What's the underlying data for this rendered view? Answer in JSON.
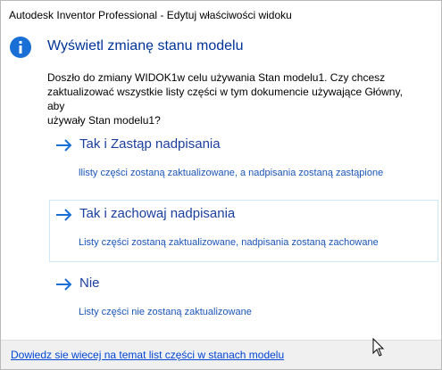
{
  "window": {
    "title": "Autodesk Inventor Professional - Edytuj właściwości widoku"
  },
  "header": {
    "icon": "info-icon",
    "main_instruction": "Wyświetl zmianę stanu modelu"
  },
  "content": {
    "line1": "Doszło do zmiany WIDOK1w celu używania Stan modelu1. Czy chcesz",
    "line2": "zaktualizować wszystkie listy części w tym dokumencie używające Główny, aby",
    "line3": "używały Stan modelu1?"
  },
  "commands": [
    {
      "icon": "arrow-right-icon",
      "title": "Tak i Zastąp nadpisania",
      "description": "llisty części zostaną zaktualizowane, a nadpisania zostaną zastąpione"
    },
    {
      "icon": "arrow-right-icon",
      "title": "Tak i zachowaj nadpisania",
      "description": "Listy części zostaną zaktualizowane, nadpisania zostaną zachowane",
      "hovered": true
    },
    {
      "icon": "arrow-right-icon",
      "title": "Nie",
      "description": "Listy części nie zostaną zaktualizowane"
    }
  ],
  "footer": {
    "link": "Dowiedz sie wiecej na temat list części w stanach modelu"
  },
  "colors": {
    "accent": "#1a6fd6",
    "instruction": "#003399",
    "command_title": "#1a3f9e",
    "command_desc": "#1a55b8",
    "hover_border": "#cde8f7",
    "footer_bg": "#f0f0f0",
    "link": "#0046d5"
  }
}
